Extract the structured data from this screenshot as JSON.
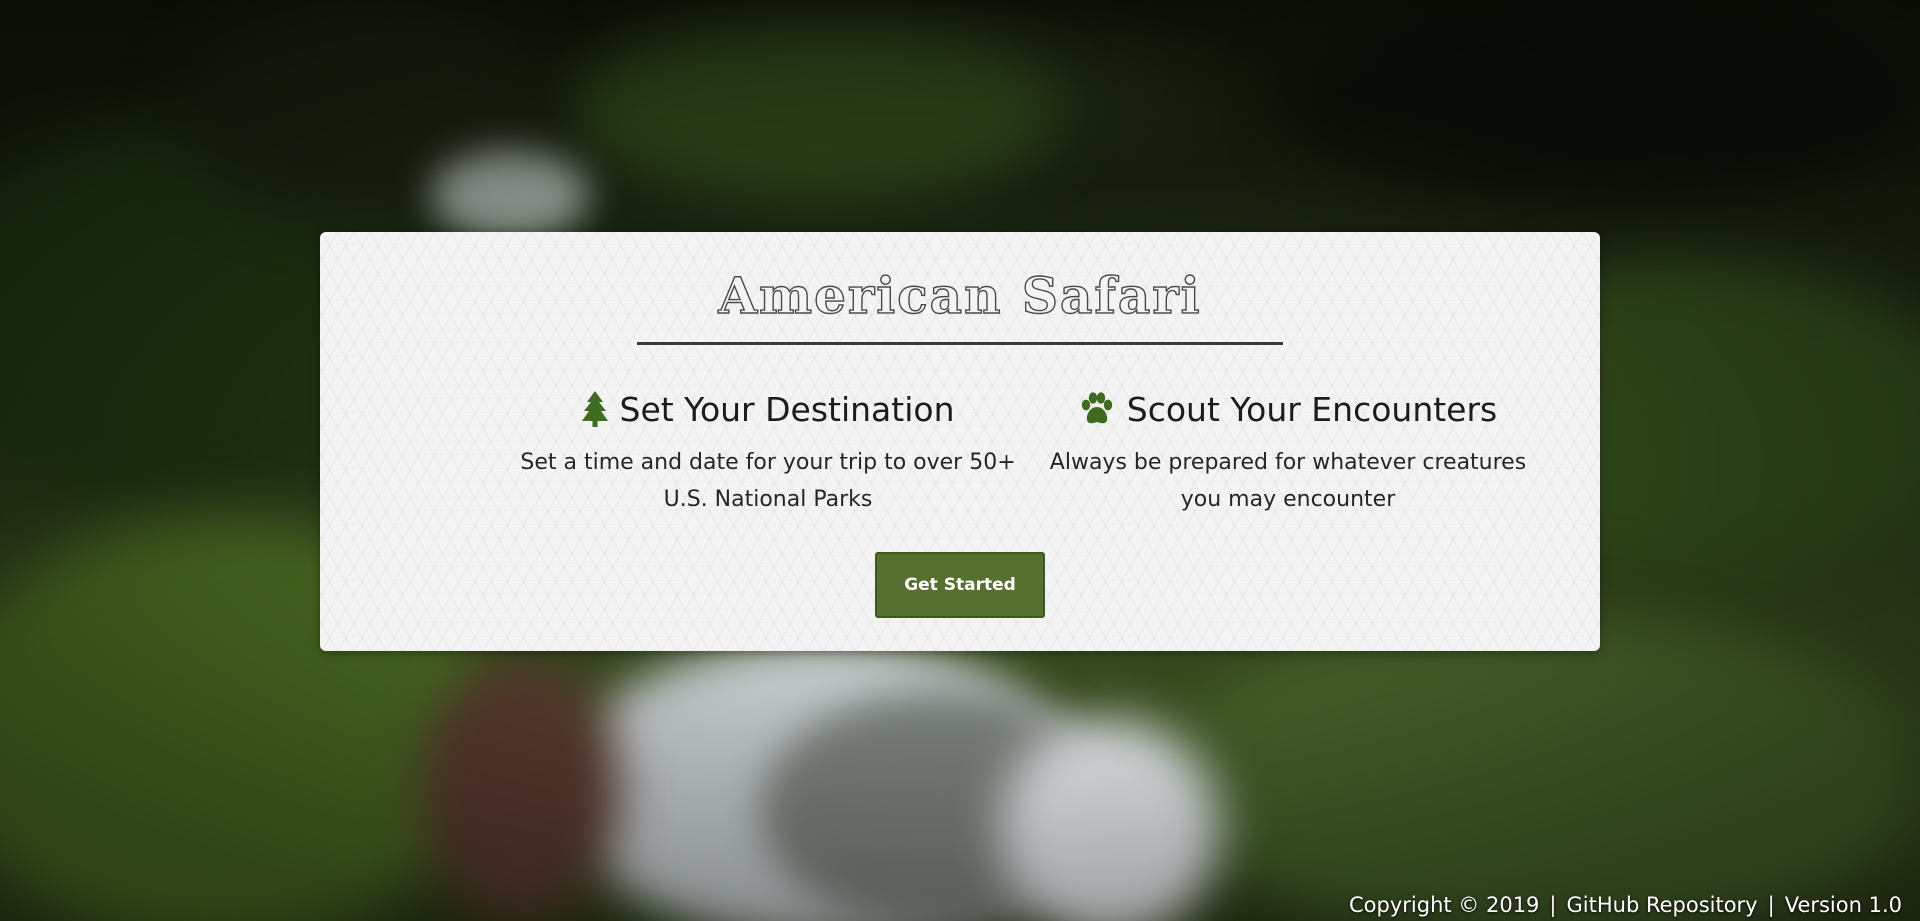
{
  "hero": {
    "title": "American Safari"
  },
  "features": [
    {
      "icon": "tree-icon",
      "heading": "Set Your Destination",
      "description": "Set a time and date for your trip to over 50+ U.S. National Parks"
    },
    {
      "icon": "paw-icon",
      "heading": "Scout Your Encounters",
      "description": "Always be prepared for whatever creatures you may encounter"
    }
  ],
  "cta": {
    "label": "Get Started"
  },
  "footer": {
    "copyright": "Copyright © 2019",
    "separator": "|",
    "repo_link": "GitHub Repository",
    "version": "Version 1.0"
  },
  "colors": {
    "accent": "#55702f",
    "icon_green": "#3f6b1f",
    "card_bg": "#f4f4f4",
    "text_dark": "#1c1c1c"
  }
}
